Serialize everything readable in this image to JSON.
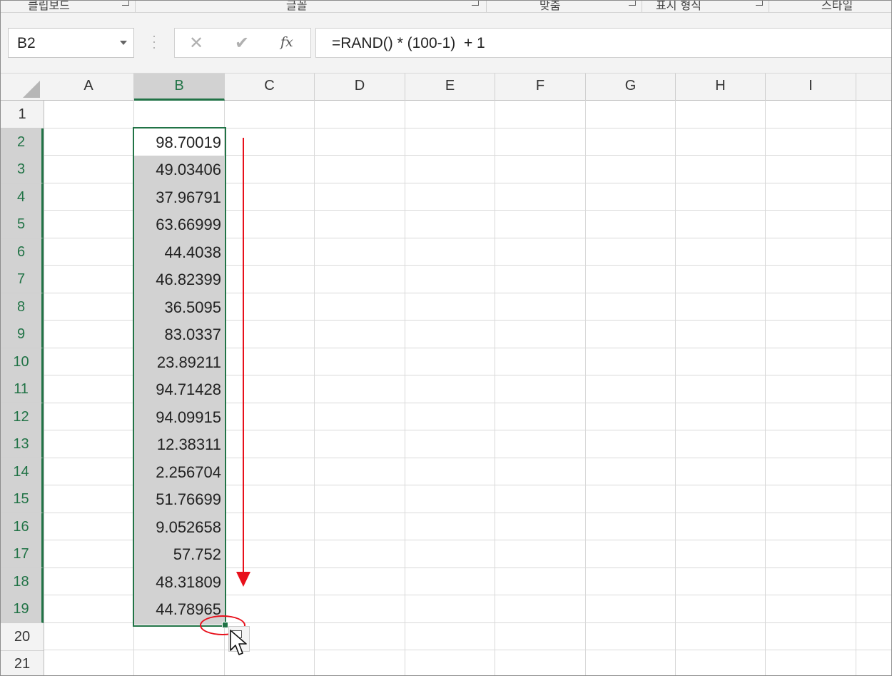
{
  "ribbon": {
    "groups": [
      "클립보드",
      "글꼴",
      "맞춤",
      "표시 형식",
      "스타일"
    ]
  },
  "formula_bar": {
    "name_box": "B2",
    "cancel_glyph": "✕",
    "enter_glyph": "✔",
    "fx_label": "fx",
    "formula": "=RAND() * (100-1)  + 1"
  },
  "sheet": {
    "columns": [
      "A",
      "B",
      "C",
      "D",
      "E",
      "F",
      "G",
      "H",
      "I"
    ],
    "rows": [
      "1",
      "2",
      "3",
      "4",
      "5",
      "6",
      "7",
      "8",
      "9",
      "10",
      "11",
      "12",
      "13",
      "14",
      "15",
      "16",
      "17",
      "18",
      "19",
      "20",
      "21"
    ],
    "selected_column": "B",
    "selected_range": "B2:B19",
    "active_cell": "B2",
    "column_b_values": [
      "98.70019",
      "49.03406",
      "37.96791",
      "63.66999",
      "44.4038",
      "46.82399",
      "36.5095",
      "83.0337",
      "23.89211",
      "94.71428",
      "94.09915",
      "12.38311",
      "2.256704",
      "51.76699",
      "9.052658",
      "57.752",
      "48.31809",
      "44.78965"
    ]
  },
  "annotation": {
    "arrow_color": "#e8101b",
    "ellipse_color": "#e8101b",
    "meaning": "drag fill handle down"
  },
  "colors": {
    "selection_accent": "#217346",
    "selection_fill": "#d2d2d2"
  }
}
